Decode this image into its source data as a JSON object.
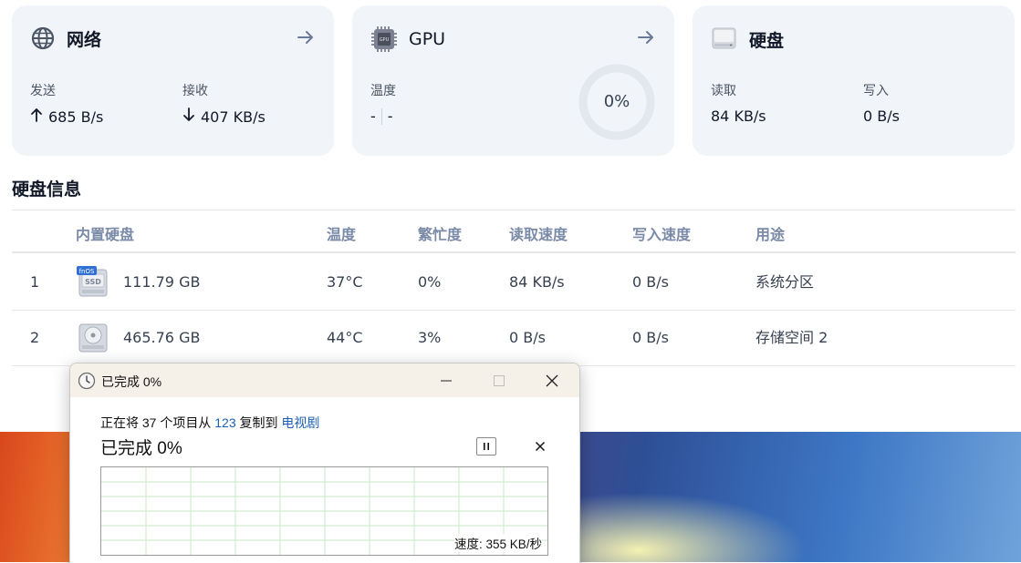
{
  "cards": {
    "network": {
      "title": "网络",
      "icon": "globe-icon",
      "send_label": "发送",
      "send_value": "685 B/s",
      "recv_label": "接收",
      "recv_value": "407 KB/s"
    },
    "gpu": {
      "title": "GPU",
      "icon": "gpu-chip-icon",
      "temp_label": "温度",
      "temp_value": "-",
      "temp_value2": "-",
      "usage": "0%",
      "usage_fraction": 0
    },
    "disk": {
      "title": "硬盘",
      "icon": "hard-drive-icon",
      "read_label": "读取",
      "read_value": "84 KB/s",
      "write_label": "写入",
      "write_value": "0 B/s"
    }
  },
  "disk_info": {
    "title": "硬盘信息",
    "columns": [
      "内置硬盘",
      "温度",
      "繁忙度",
      "读取速度",
      "写入速度",
      "用途"
    ],
    "rows": [
      {
        "index": "1",
        "badge": "fnOS",
        "drive_label": "SSD",
        "size": "111.79 GB",
        "temp": "37°C",
        "busy": "0%",
        "read": "84 KB/s",
        "write": "0 B/s",
        "usage": "系统分区"
      },
      {
        "index": "2",
        "size": "465.76 GB",
        "temp": "44°C",
        "busy": "3%",
        "read": "0 B/s",
        "write": "0 B/s",
        "usage": "存储空间 2"
      }
    ]
  },
  "copy_dialog": {
    "title": "已完成 0%",
    "line_prefix": "正在将 37 个项目从 ",
    "source": "123",
    "line_mid": " 复制到 ",
    "destination": "电视剧",
    "progress_text": "已完成 0%",
    "speed_text": "速度: 355 KB/秒",
    "grid_color": "#c8e8c8"
  }
}
